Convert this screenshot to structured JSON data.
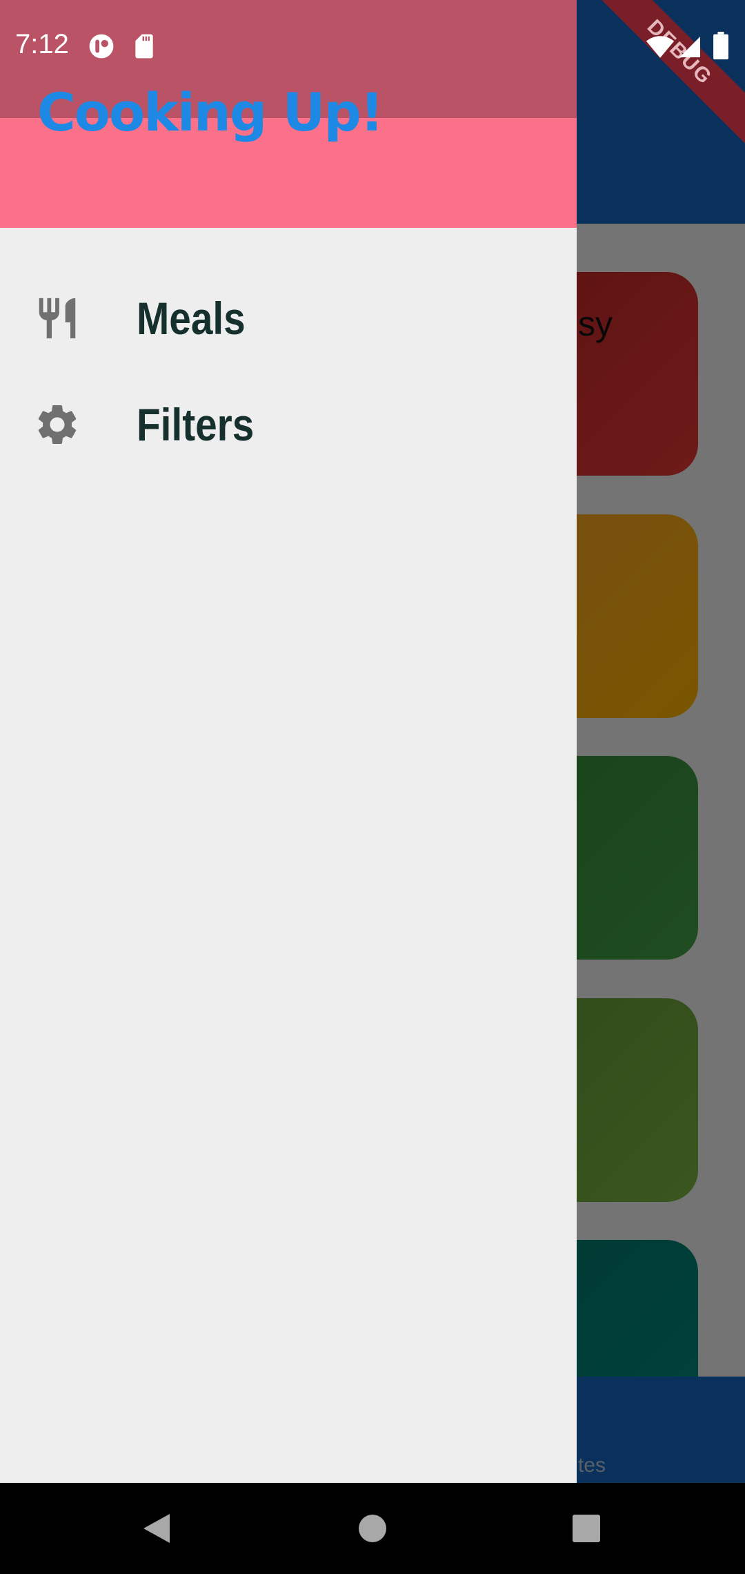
{
  "status_bar": {
    "time": "7:12"
  },
  "debug_banner": "DEBUG",
  "drawer": {
    "title": "Cooking Up!",
    "items": [
      {
        "label": "Meals",
        "icon": "restaurant-icon"
      },
      {
        "label": "Filters",
        "icon": "settings-icon"
      }
    ]
  },
  "background": {
    "cards": [
      {
        "partial_text": "sy",
        "color": "#d32f2f"
      },
      {
        "text": "",
        "color": "#ffb300"
      },
      {
        "text": "",
        "color": "#43a047"
      },
      {
        "text": "",
        "color": "#7cb342"
      },
      {
        "text": "",
        "color": "#00897b"
      }
    ],
    "bottom_tab_partial_label": "tes"
  },
  "colors": {
    "drawer_header": "#fb7189",
    "title": "#1e88e5",
    "drawer_bg": "#eeeeee",
    "app_bar": "#1565c0"
  }
}
